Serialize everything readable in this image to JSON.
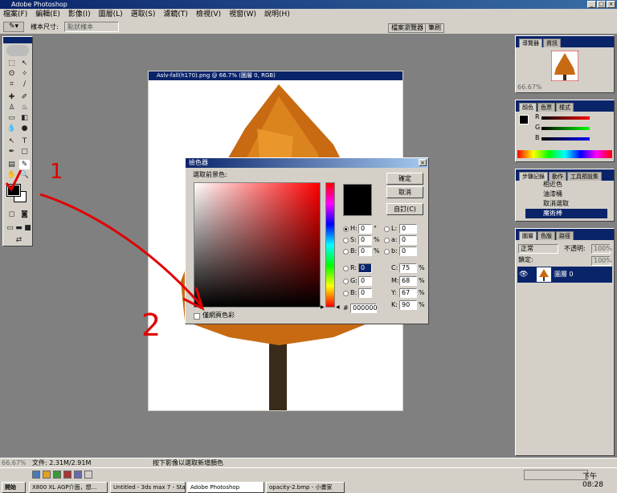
{
  "app": {
    "title": "Adobe Photoshop",
    "window_buttons": [
      "_",
      "□",
      "×"
    ]
  },
  "menu": [
    "檔案(F)",
    "編輯(E)",
    "影像(I)",
    "圖層(L)",
    "選取(S)",
    "濾鏡(T)",
    "檢視(V)",
    "視窗(W)",
    "說明(H)"
  ],
  "options_bar": {
    "sample_size_label": "樣本尺寸:",
    "sample_size_value": "點狀樣本",
    "tab_browser": "檔案瀏覽器",
    "tab_brush": "筆刷"
  },
  "document": {
    "title": "Aslv-fall(h170).png @ 66.7% (圖層 0, RGB)"
  },
  "color_picker": {
    "title": "檢色器",
    "prompt": "選取前景色:",
    "ok": "確定",
    "cancel": "取消",
    "custom": "自訂(C)",
    "web_only": "僅網頁色彩",
    "fields": {
      "H": {
        "label": "H:",
        "value": "0",
        "unit": "°"
      },
      "S": {
        "label": "S:",
        "value": "0",
        "unit": "%"
      },
      "Bv": {
        "label": "B:",
        "value": "0",
        "unit": "%"
      },
      "R": {
        "label": "R:",
        "value": "0"
      },
      "G": {
        "label": "G:",
        "value": "0"
      },
      "B": {
        "label": "B:",
        "value": "0"
      },
      "L": {
        "label": "L:",
        "value": "0"
      },
      "a": {
        "label": "a:",
        "value": "0"
      },
      "b": {
        "label": "b:",
        "value": "0"
      },
      "C": {
        "label": "C:",
        "value": "75",
        "unit": "%"
      },
      "M": {
        "label": "M:",
        "value": "68",
        "unit": "%"
      },
      "Y": {
        "label": "Y:",
        "value": "67",
        "unit": "%"
      },
      "K": {
        "label": "K:",
        "value": "90",
        "unit": "%"
      }
    },
    "hex_label": "#",
    "hex": "000000",
    "selected_color": "#000000"
  },
  "panels": {
    "navigator": {
      "tabs": [
        "導覽器",
        "資訊"
      ],
      "zoom": "66.67%"
    },
    "color": {
      "tabs": [
        "顏色",
        "色票",
        "樣式"
      ],
      "channels": [
        "R",
        "G",
        "B"
      ]
    },
    "history": {
      "tabs": [
        "步驟記錄",
        "動作",
        "工具預設集"
      ],
      "items": [
        "相近色",
        "油漆桶",
        "取消選取",
        "魔術棒"
      ]
    },
    "layers": {
      "tabs": [
        "圖層",
        "色版",
        "路徑"
      ],
      "blend_mode": "正常",
      "opacity_label": "不透明:",
      "opacity_value": "100%",
      "lock_label": "鎖定:",
      "fill_value": "100%",
      "layer_name": "圖層 0"
    }
  },
  "status": {
    "zoom": "66.67%",
    "doc_size": "文件: 2.31M/2.91M",
    "hint": "按下影像以選取新增顏色"
  },
  "taskbar": {
    "start": "開始",
    "tasks": [
      "X800 XL AGP介面，想...",
      "Untitled - 3ds max 7 - Sta...",
      "Adobe Photoshop",
      "opacity-2.bmp - 小畫家"
    ],
    "clock": "下午 08:28"
  },
  "annotations": [
    "1",
    "2"
  ]
}
